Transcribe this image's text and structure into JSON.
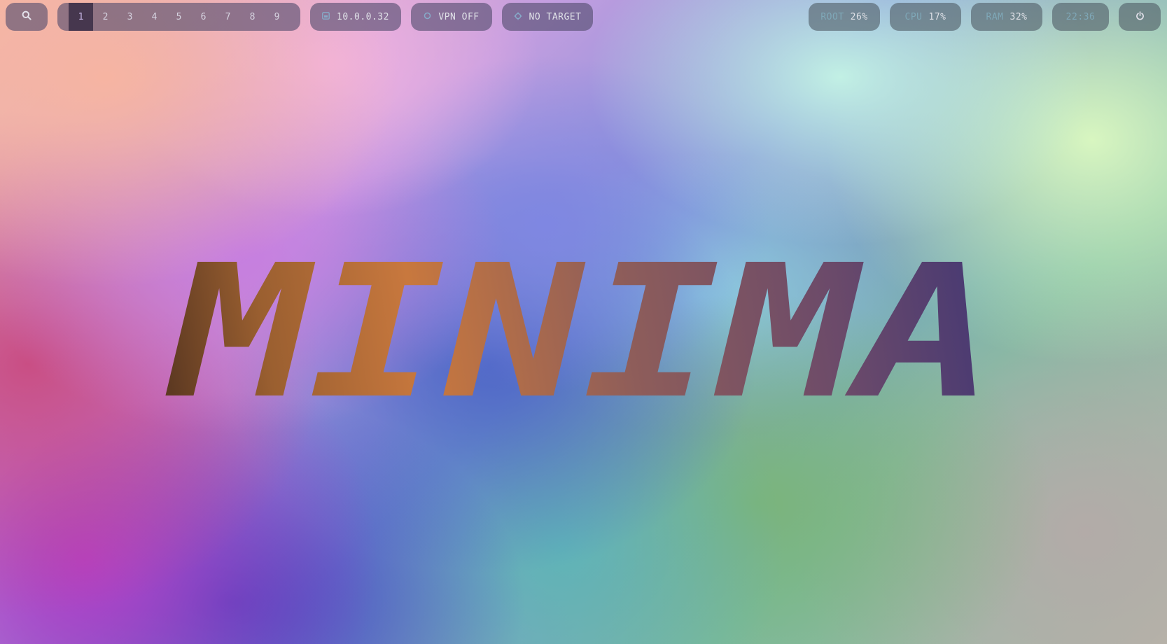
{
  "hero": {
    "title": "MINIMA"
  },
  "topbar": {
    "search_icon": "search-icon",
    "workspaces": [
      {
        "label": "1",
        "active": true
      },
      {
        "label": "2",
        "active": false
      },
      {
        "label": "3",
        "active": false
      },
      {
        "label": "4",
        "active": false
      },
      {
        "label": "5",
        "active": false
      },
      {
        "label": "6",
        "active": false
      },
      {
        "label": "7",
        "active": false
      },
      {
        "label": "8",
        "active": false
      },
      {
        "label": "9",
        "active": false
      }
    ],
    "ip": {
      "icon": "network-icon",
      "value": "10.0.0.32"
    },
    "vpn": {
      "icon": "vpn-icon",
      "value": "VPN OFF"
    },
    "target": {
      "icon": "crosshair-icon",
      "value": "NO TARGET"
    },
    "root": {
      "label": "ROOT",
      "value": "26%"
    },
    "cpu": {
      "label": "CPU",
      "value": "17%"
    },
    "ram": {
      "label": "RAM",
      "value": "32%"
    },
    "clock": {
      "value": "22:36"
    },
    "power_icon": "power-icon"
  },
  "colors": {
    "accent": "#7fa8b8",
    "active_workspace": "#c8b6e6",
    "hero_gradient": [
      "#5e3a22",
      "#c8783e",
      "#7a5565",
      "#463670"
    ]
  }
}
